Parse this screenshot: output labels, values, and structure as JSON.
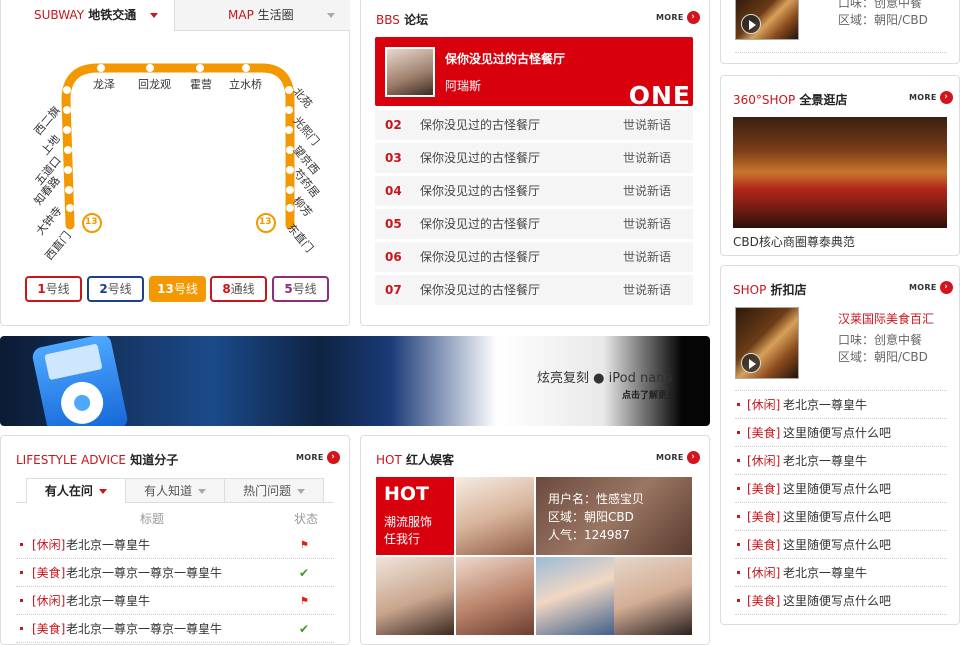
{
  "subway": {
    "tab_active_en": "SUBWAY",
    "tab_active_cn": "地铁交通",
    "tab_inactive_en": "MAP",
    "tab_inactive_cn": "生活圈",
    "stations_top": [
      "龙泽",
      "回龙观",
      "霍营",
      "立水桥"
    ],
    "stations_left": [
      "西二旗",
      "上地",
      "五道口",
      "知春路",
      "大钟寺",
      "西直门"
    ],
    "stations_right": [
      "北苑",
      "光熙门",
      "望京西",
      "芍药居",
      "柳芳",
      "东直门"
    ],
    "line_badge": "13",
    "line_buttons": [
      {
        "num": "1",
        "suffix": "号线",
        "color": "#c8161d"
      },
      {
        "num": "2",
        "suffix": "号线",
        "color": "#1d3f8f"
      },
      {
        "num": "13",
        "suffix": "号线",
        "color": "#f39800"
      },
      {
        "num": "8",
        "suffix": "通线",
        "color": "#c8161d"
      },
      {
        "num": "5",
        "suffix": "号线",
        "color": "#8e2f7d"
      }
    ]
  },
  "bbs": {
    "title_en": "BBS",
    "title_cn": "论坛",
    "more": "MORE",
    "hero_title": "保你没见过的古怪餐厅",
    "hero_user": "阿瑞斯",
    "hero_badge": "ONE",
    "rows": [
      {
        "no": "02",
        "title": "保你没见过的古怪餐厅",
        "cat": "世说新语"
      },
      {
        "no": "03",
        "title": "保你没见过的古怪餐厅",
        "cat": "世说新语"
      },
      {
        "no": "04",
        "title": "保你没见过的古怪餐厅",
        "cat": "世说新语"
      },
      {
        "no": "05",
        "title": "保你没见过的古怪餐厅",
        "cat": "世说新语"
      },
      {
        "no": "06",
        "title": "保你没见过的古怪餐厅",
        "cat": "世说新语"
      },
      {
        "no": "07",
        "title": "保你没见过的古怪餐厅",
        "cat": "世说新语"
      }
    ]
  },
  "banner": {
    "text": "炫亮复刻",
    "brand": "iPod nano",
    "cta": "点击了解更多"
  },
  "lifestyle": {
    "title_en": "LIFESTYLE ADVICE",
    "title_cn": "知道分子",
    "more": "MORE",
    "tabs": [
      "有人在问",
      "有人知道",
      "热门问题"
    ],
    "col_title": "标题",
    "col_status": "状态",
    "rows": [
      {
        "tag": "[休闲]",
        "text": "老北京一尊皇牛",
        "status": "flag"
      },
      {
        "tag": "[美食]",
        "text": "老北京一尊京一尊京一尊皇牛",
        "status": "check"
      },
      {
        "tag": "[休闲]",
        "text": "老北京一尊皇牛",
        "status": "flag"
      },
      {
        "tag": "[美食]",
        "text": "老北京一尊京一尊京一尊皇牛",
        "status": "check"
      }
    ]
  },
  "hot": {
    "title_en": "HOT",
    "title_cn": "红人娱客",
    "more": "MORE",
    "tile_title": "HOT",
    "tile_line1": "潮流服饰",
    "tile_line2": "任我行",
    "user_label": "用户名：性感宝贝",
    "area_label": "区域：朝阳CBD",
    "pop_label": "人气：124987"
  },
  "right": {
    "top_taste": "口味：创意中餐",
    "top_area": "区域：朝阳/CBD",
    "shop360_en": "360°SHOP",
    "shop360_cn": "全景逛店",
    "more": "MORE",
    "shop360_caption": "CBD核心商圈尊泰典范",
    "shop_en": "SHOP",
    "shop_cn": "折扣店",
    "shop_name": "汉莱国际美食百汇",
    "shop_taste": "口味：创意中餐",
    "shop_area": "区域：朝阳/CBD",
    "rows": [
      {
        "tag": "[休闲]",
        "text": "老北京一尊皇牛"
      },
      {
        "tag": "[美食]",
        "text": "这里随便写点什么吧"
      },
      {
        "tag": "[休闲]",
        "text": "老北京一尊皇牛"
      },
      {
        "tag": "[美食]",
        "text": "这里随便写点什么吧"
      },
      {
        "tag": "[美食]",
        "text": "这里随便写点什么吧"
      },
      {
        "tag": "[美食]",
        "text": "这里随便写点什么吧"
      },
      {
        "tag": "[休闲]",
        "text": "老北京一尊皇牛"
      },
      {
        "tag": "[美食]",
        "text": "这里随便写点什么吧"
      }
    ]
  }
}
